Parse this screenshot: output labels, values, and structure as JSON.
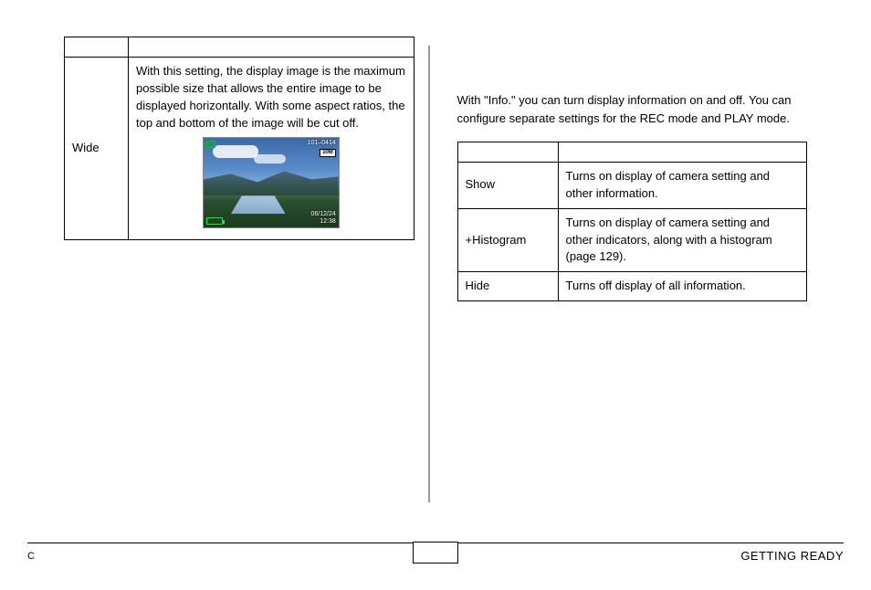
{
  "left_table": {
    "row_label": "Wide",
    "row_desc": "With this setting, the display image is the maximum possible size that allows the entire image to be displayed horizontally. With some aspect ratios, the top and bottom of the image will be cut off.",
    "thumb": {
      "file_no": "101–0414",
      "badge": "10M",
      "date": "06/12/24",
      "time": "12:38"
    }
  },
  "right": {
    "intro": "With \"Info.\" you can turn display information on and off. You can configure separate settings for the REC mode and PLAY mode.",
    "rows": [
      {
        "label": "Show",
        "desc": "Turns on display of camera setting and other information."
      },
      {
        "label": "+Histogram",
        "desc": "Turns on display of camera setting and other indicators, along with a histogram (page 129)."
      },
      {
        "label": "Hide",
        "desc": "Turns off display of all information."
      }
    ]
  },
  "footer": {
    "left": "C",
    "section": "GETTING READY"
  }
}
